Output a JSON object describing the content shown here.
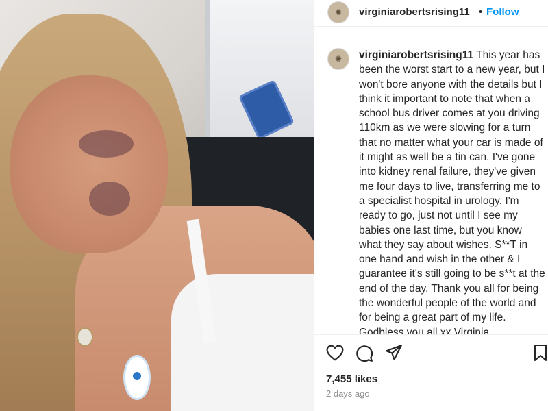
{
  "post": {
    "username": "virginiarobertsrising11",
    "follow_label": "Follow",
    "separator": "•",
    "caption_user": "virginiarobertsrising11",
    "caption_text": "This year has been the worst start to a new year, but I won't bore anyone with the details but I think it important to note that when a school bus driver comes at you driving 110km as we were slowing for a turn that no matter what your car is made of it might as well be a tin can. I've gone into kidney renal failure, they've given me four days to live, transferring me to a specialist hospital in urology. I'm ready to go, just not until I see my babies one last time, but you know what they say about wishes. S**T in one hand and wish in the other & I guarantee it's still going to be s**t at the end of the day. Thank you all for being the wonderful people of the world and for being a great part of my life. Godbless you all xx Virginia",
    "likes": "7,455 likes",
    "timestamp": "2 days ago"
  },
  "icons": {
    "like": "heart-icon",
    "comment": "comment-icon",
    "share": "paper-plane-icon",
    "save": "bookmark-icon"
  },
  "colors": {
    "follow_blue": "#0095f6",
    "text": "#262626",
    "muted": "#8e8e8e"
  }
}
